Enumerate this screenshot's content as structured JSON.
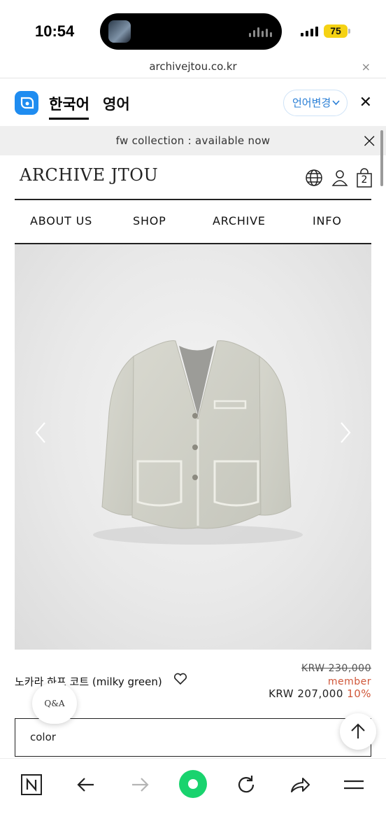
{
  "status_bar": {
    "time": "10:54",
    "battery": "75"
  },
  "browser": {
    "url": "archivejtou.co.kr",
    "close_glyph": "×"
  },
  "translate_bar": {
    "source_lang": "한국어",
    "target_lang": "영어",
    "change_label": "언어변경",
    "close_glyph": "✕"
  },
  "announcement": {
    "text": "fw collection : available now",
    "close_glyph": "×"
  },
  "header": {
    "logo": "ARCHIVE JTOU",
    "cart_count": "2"
  },
  "nav": {
    "items": [
      "ABOUT US",
      "SHOP",
      "ARCHIVE",
      "INFO"
    ]
  },
  "product": {
    "name": "노카라 하프 코트 (milky green)",
    "original_price": "KRW 230,000",
    "member_label": "member",
    "sale_price": "KRW 207,000",
    "discount": "10%",
    "option_label": "color"
  },
  "floating": {
    "qa_label": "Q&A"
  },
  "colors": {
    "accent_blue": "#1f8cf0",
    "discount_red": "#d0573a",
    "nav_green": "#19d36e"
  },
  "icons": [
    "globe-icon",
    "user-icon",
    "cart-icon",
    "chevron-left-icon",
    "chevron-right-icon",
    "heart-icon",
    "arrow-up-icon",
    "naver-icon",
    "back-icon",
    "forward-icon",
    "green-dot-icon",
    "refresh-icon",
    "share-icon",
    "menu-icon"
  ]
}
